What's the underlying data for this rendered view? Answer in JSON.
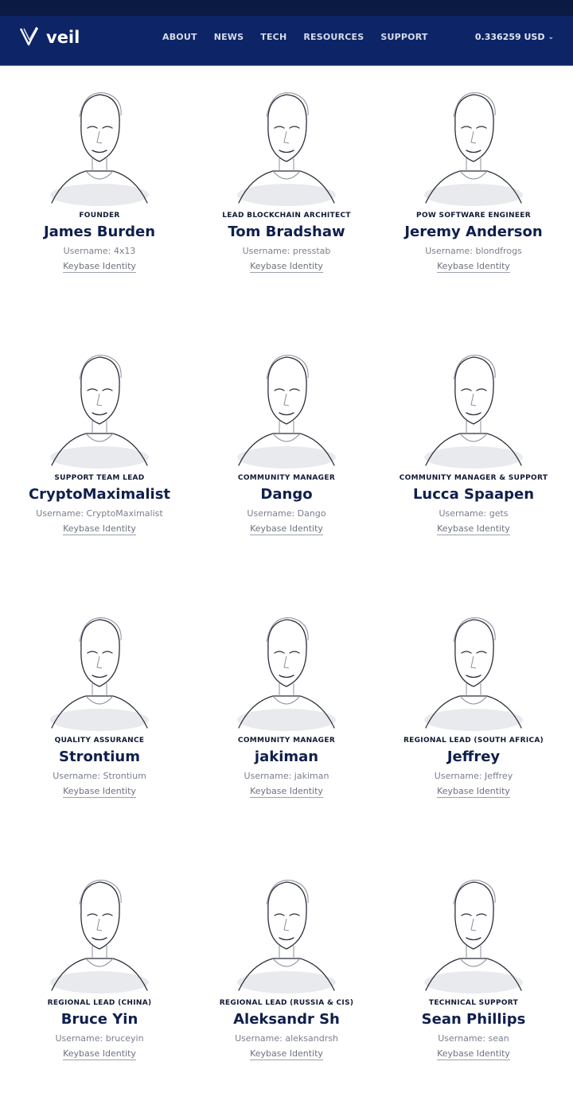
{
  "nav": {
    "brand": "veil",
    "menu": [
      "ABOUT",
      "NEWS",
      "TECH",
      "RESOURCES",
      "SUPPORT"
    ],
    "price": "0.336259 USD",
    "price_icon": "chevron-down-icon"
  },
  "team": [
    {
      "role": "FOUNDER",
      "name": "James Burden",
      "username": "Username: 4x13",
      "link": "Keybase Identity"
    },
    {
      "role": "LEAD BLOCKCHAIN ARCHITECT",
      "name": "Tom Bradshaw",
      "username": "Username: presstab",
      "link": "Keybase Identity"
    },
    {
      "role": "POW SOFTWARE ENGINEER",
      "name": "Jeremy Anderson",
      "username": "Username: blondfrogs",
      "link": "Keybase Identity"
    },
    {
      "role": "SUPPORT TEAM LEAD",
      "name": "CryptoMaximalist",
      "username": "Username: CryptoMaximalist",
      "link": "Keybase Identity"
    },
    {
      "role": "COMMUNITY MANAGER",
      "name": "Dango",
      "username": "Username: Dango",
      "link": "Keybase Identity"
    },
    {
      "role": "COMMUNITY MANAGER & SUPPORT",
      "name": "Lucca Spaapen",
      "username": "Username: gets",
      "link": "Keybase Identity"
    },
    {
      "role": "QUALITY ASSURANCE",
      "name": "Strontium",
      "username": "Username: Strontium",
      "link": "Keybase Identity"
    },
    {
      "role": "COMMUNITY MANAGER",
      "name": "jakiman",
      "username": "Username: jakiman",
      "link": "Keybase Identity"
    },
    {
      "role": "REGIONAL LEAD (SOUTH AFRICA)",
      "name": "Jeffrey",
      "username": "Username: Jeffrey",
      "link": "Keybase Identity"
    },
    {
      "role": "REGIONAL LEAD (CHINA)",
      "name": "Bruce Yin",
      "username": "Username: bruceyin",
      "link": "Keybase Identity"
    },
    {
      "role": "REGIONAL LEAD (RUSSIA & CIS)",
      "name": "Aleksandr Sh",
      "username": "Username: aleksandrsh",
      "link": "Keybase Identity"
    },
    {
      "role": "TECHNICAL SUPPORT",
      "name": "Sean Phillips",
      "username": "Username: sean",
      "link": "Keybase Identity"
    }
  ]
}
